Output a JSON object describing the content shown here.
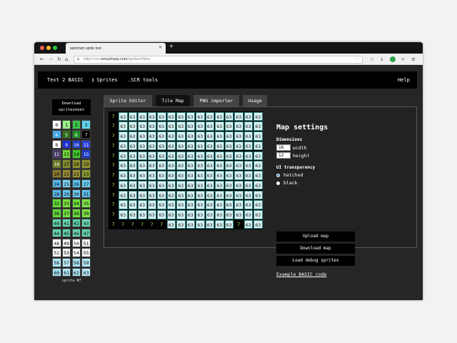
{
  "browser": {
    "tab_title": "spectrum sprite tool",
    "url_prefix": "https://zx.",
    "url_host": "remysharp.com",
    "url_path": "/sprites/#tiles",
    "new_tab_glyph": "+",
    "close_glyph": "✕",
    "icons": [
      "back-icon",
      "forward-icon",
      "reload-icon",
      "home-icon",
      "lock-icon",
      "more-icon",
      "bookmark-icon",
      "download-icon",
      "extension-icon",
      "menu-icon"
    ]
  },
  "nav": {
    "text2basic": "Text 2 BASIC",
    "sprites": "Sprites",
    "scr_tools": ".SCR tools",
    "help": "Help"
  },
  "download_spritesheet": "Download spritesheet",
  "palette": [
    {
      "n": "0",
      "bg": "#ffffff",
      "fg": "#000000"
    },
    {
      "n": "1",
      "bg": "#9bf08a",
      "fg": "#000000"
    },
    {
      "n": "2",
      "bg": "#3cc44a",
      "fg": "#000000"
    },
    {
      "n": "3",
      "bg": "#5fd2ec",
      "fg": "#000000"
    },
    {
      "n": "4",
      "bg": "#48a8e8",
      "fg": "#ffffff"
    },
    {
      "n": "5",
      "bg": "#2f6e1c",
      "fg": "#ffffff"
    },
    {
      "n": "6",
      "bg": "#1e8e24",
      "fg": "#ffffff"
    },
    {
      "n": "7",
      "bg": "#000000",
      "fg": "#ffffff"
    },
    {
      "n": "8",
      "bg": "#ffffff",
      "fg": "#000000"
    },
    {
      "n": "9",
      "bg": "#1d2fd6",
      "fg": "#ffffff"
    },
    {
      "n": "10",
      "bg": "#1f3cc8",
      "fg": "#ffffff"
    },
    {
      "n": "11",
      "bg": "#2a3fd6",
      "fg": "#ffffff"
    },
    {
      "n": "12",
      "bg": "#4b3b6a",
      "fg": "#ffffff"
    },
    {
      "n": "13",
      "bg": "#6dd63a",
      "fg": "#000000"
    },
    {
      "n": "14",
      "bg": "#3ec62a",
      "fg": "#000000"
    },
    {
      "n": "15",
      "bg": "#1a3ac8",
      "fg": "#ffffff"
    },
    {
      "n": "16",
      "bg": "#6a7a2a",
      "fg": "#ffffff"
    },
    {
      "n": "17",
      "bg": "#7f8a2c",
      "fg": "#000000"
    },
    {
      "n": "18",
      "bg": "#8a902c",
      "fg": "#000000"
    },
    {
      "n": "19",
      "bg": "#8c8e30",
      "fg": "#000000"
    },
    {
      "n": "20",
      "bg": "#8a7a2a",
      "fg": "#000000"
    },
    {
      "n": "21",
      "bg": "#9a8a30",
      "fg": "#000000"
    },
    {
      "n": "22",
      "bg": "#9a8e34",
      "fg": "#000000"
    },
    {
      "n": "23",
      "bg": "#8a9a30",
      "fg": "#000000"
    },
    {
      "n": "24",
      "bg": "#5ab8ec",
      "fg": "#000000"
    },
    {
      "n": "25",
      "bg": "#7ad2f0",
      "fg": "#000000"
    },
    {
      "n": "26",
      "bg": "#5cc4ee",
      "fg": "#000000"
    },
    {
      "n": "27",
      "bg": "#6acdf0",
      "fg": "#000000"
    },
    {
      "n": "28",
      "bg": "#5ab6ea",
      "fg": "#000000"
    },
    {
      "n": "29",
      "bg": "#66c2ee",
      "fg": "#000000"
    },
    {
      "n": "30",
      "bg": "#6ec8f0",
      "fg": "#000000"
    },
    {
      "n": "31",
      "bg": "#5cbcec",
      "fg": "#000000"
    },
    {
      "n": "32",
      "bg": "#64d83a",
      "fg": "#000000"
    },
    {
      "n": "33",
      "bg": "#78e040",
      "fg": "#000000"
    },
    {
      "n": "34",
      "bg": "#6cdc3c",
      "fg": "#000000"
    },
    {
      "n": "35",
      "bg": "#7ee448",
      "fg": "#000000"
    },
    {
      "n": "36",
      "bg": "#62d43a",
      "fg": "#000000"
    },
    {
      "n": "37",
      "bg": "#72de40",
      "fg": "#000000"
    },
    {
      "n": "38",
      "bg": "#6ada3e",
      "fg": "#000000"
    },
    {
      "n": "39",
      "bg": "#7ae244",
      "fg": "#000000"
    },
    {
      "n": "40",
      "bg": "#60d0a8",
      "fg": "#000000"
    },
    {
      "n": "41",
      "bg": "#66d4ae",
      "fg": "#000000"
    },
    {
      "n": "42",
      "bg": "#5ccca4",
      "fg": "#000000"
    },
    {
      "n": "43",
      "bg": "#6ad6b2",
      "fg": "#000000"
    },
    {
      "n": "44",
      "bg": "#62d2a8",
      "fg": "#000000"
    },
    {
      "n": "45",
      "bg": "#5ecea6",
      "fg": "#000000"
    },
    {
      "n": "46",
      "bg": "#68d4ae",
      "fg": "#000000"
    },
    {
      "n": "47",
      "bg": "#64d0aa",
      "fg": "#000000"
    },
    {
      "n": "48",
      "bg": "#ffffff",
      "fg": "#000000"
    },
    {
      "n": "49",
      "bg": "#f2f2f2",
      "fg": "#000000"
    },
    {
      "n": "50",
      "bg": "#ffffff",
      "fg": "#000000"
    },
    {
      "n": "51",
      "bg": "#f4f4f4",
      "fg": "#000000"
    },
    {
      "n": "52",
      "bg": "#ffffff",
      "fg": "#000000"
    },
    {
      "n": "53",
      "bg": "#f0f0f0",
      "fg": "#000000"
    },
    {
      "n": "54",
      "bg": "#ffffff",
      "fg": "#000000"
    },
    {
      "n": "55",
      "bg": "#f6f6f6",
      "fg": "#000000"
    },
    {
      "n": "56",
      "bg": "#aee4f4",
      "fg": "#000000"
    },
    {
      "n": "57",
      "bg": "#b8e8f6",
      "fg": "#000000"
    },
    {
      "n": "58",
      "bg": "#a8e0f2",
      "fg": "#000000"
    },
    {
      "n": "59",
      "bg": "#b2e6f4",
      "fg": "#000000"
    },
    {
      "n": "60",
      "bg": "#a6def2",
      "fg": "#000000"
    },
    {
      "n": "61",
      "bg": "#b0e4f4",
      "fg": "#000000"
    },
    {
      "n": "62",
      "bg": "#aae2f2",
      "fg": "#000000"
    },
    {
      "n": "63",
      "bg": "#b4e6f4",
      "fg": "#000000"
    }
  ],
  "selected_sprite": "sprite #7",
  "tabs": [
    "Sprite Editor",
    "Tile Map",
    "PNG importer",
    "Usage"
  ],
  "active_tab": "Tile Map",
  "tilemap": {
    "cols": 16,
    "rows": 12,
    "cells": [
      [
        "7",
        "63",
        "63",
        "63",
        "63",
        "63",
        "63",
        "63",
        "63",
        "63",
        "63",
        "63",
        "63",
        "63",
        "63",
        "63"
      ],
      [
        "7",
        "63",
        "63",
        "63",
        "63",
        "63",
        "63",
        "63",
        "63",
        "63",
        "63",
        "63",
        "63",
        "63",
        "63",
        "63"
      ],
      [
        "7",
        "63",
        "63",
        "63",
        "63",
        "63",
        "63",
        "63",
        "63",
        "63",
        "63",
        "63",
        "63",
        "63",
        "63",
        "63"
      ],
      [
        "7",
        "63",
        "63",
        "63",
        "63",
        "63",
        "63",
        "63",
        "63",
        "63",
        "63",
        "63",
        "63",
        "63",
        "63",
        "63"
      ],
      [
        "7",
        "63",
        "63",
        "63",
        "63",
        "63",
        "63",
        "63",
        "63",
        "63",
        "63",
        "63",
        "63",
        "63",
        "63",
        "63"
      ],
      [
        "7",
        "63",
        "63",
        "63",
        "63",
        "63",
        "63",
        "63",
        "63",
        "63",
        "63",
        "63",
        "63",
        "63",
        "63",
        "63"
      ],
      [
        "7",
        "63",
        "63",
        "63",
        "63",
        "63",
        "63",
        "63",
        "63",
        "63",
        "63",
        "63",
        "63",
        "63",
        "63",
        "63"
      ],
      [
        "7",
        "63",
        "63",
        "63",
        "63",
        "63",
        "63",
        "63",
        "63",
        "63",
        "63",
        "63",
        "63",
        "63",
        "63",
        "63"
      ],
      [
        "7",
        "63",
        "63",
        "63",
        "63",
        "63",
        "63",
        "63",
        "63",
        "63",
        "63",
        "63",
        "63",
        "63",
        "63",
        "63"
      ],
      [
        "7",
        "63",
        "63",
        "63",
        "63",
        "63",
        "63",
        "63",
        "63",
        "63",
        "63",
        "63",
        "63",
        "63",
        "63",
        "63"
      ],
      [
        "7",
        "63",
        "63",
        "63",
        "63",
        "63",
        "63",
        "63",
        "63",
        "63",
        "63",
        "63",
        "63",
        "63",
        "63",
        "63"
      ],
      [
        "7",
        "7",
        "7",
        "7",
        "7",
        "7",
        "63",
        "63",
        "63",
        "63",
        "63",
        "63",
        "63",
        "7",
        "63",
        "63"
      ]
    ]
  },
  "settings": {
    "title": "Map settings",
    "dimensions_label": "Dimensions",
    "width_value": "16",
    "width_label": "width",
    "height_value": "12",
    "height_label": "height",
    "transparency_label": "UI transparency",
    "option_hatched": "hatched",
    "option_black": "black",
    "selected_option": "hatched",
    "upload_map": "Upload map",
    "download_map": "Download map",
    "load_debug": "Load debug sprites",
    "example_link": "Example BASIC code"
  }
}
